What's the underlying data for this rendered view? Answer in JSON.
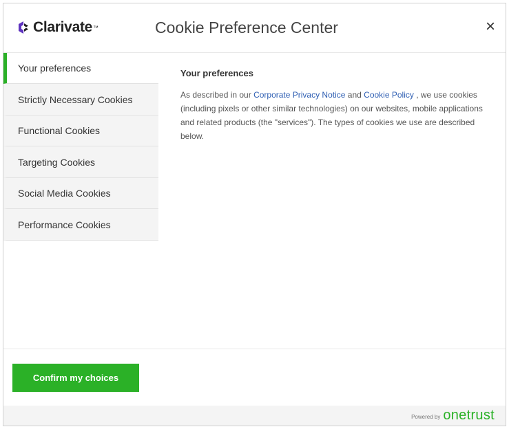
{
  "header": {
    "logo_text": "Clarivate",
    "logo_tm": "™",
    "title": "Cookie Preference Center",
    "close_glyph": "×"
  },
  "sidebar": {
    "items": [
      {
        "label": "Your preferences",
        "active": true
      },
      {
        "label": "Strictly Necessary Cookies",
        "active": false
      },
      {
        "label": "Functional Cookies",
        "active": false
      },
      {
        "label": "Targeting Cookies",
        "active": false
      },
      {
        "label": "Social Media Cookies",
        "active": false
      },
      {
        "label": "Performance Cookies",
        "active": false
      }
    ]
  },
  "panel": {
    "title": "Your preferences",
    "text_before": "As described in our ",
    "link1": "Corporate Privacy Notice",
    "text_middle": "  and ",
    "link2": "Cookie Policy",
    "text_after": " , we use cookies (including pixels or other similar technologies) on our websites, mobile applications and related products (the \"services\"). The types of cookies we use are described below."
  },
  "footer": {
    "confirm_label": "Confirm my choices",
    "powered_by": "Powered by",
    "brand": "onetrust"
  },
  "colors": {
    "accent": "#2bb127",
    "link": "#2f5fb3",
    "sidebar_bg": "#f4f4f4",
    "logo_primary": "#5e33bf"
  },
  "icons": {
    "logo": "clarivate-logo-icon",
    "close": "close-icon"
  }
}
